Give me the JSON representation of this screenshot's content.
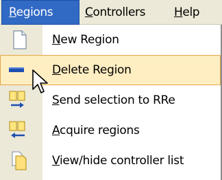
{
  "menubar": {
    "items": [
      {
        "mnemonic": "R",
        "rest": "egions"
      },
      {
        "mnemonic": "C",
        "rest": "ontrollers"
      },
      {
        "mnemonic": "H",
        "rest": "elp"
      }
    ]
  },
  "menu": {
    "items": [
      {
        "mnemonic": "N",
        "rest": "ew Region",
        "icon": "new-region-icon"
      },
      {
        "mnemonic": "D",
        "rest": "elete Region",
        "icon": "delete-region-icon"
      },
      {
        "mnemonic": "S",
        "rest": "end selection to RRe",
        "icon": "send-selection-icon"
      },
      {
        "mnemonic": "A",
        "rest": "cquire regions",
        "icon": "acquire-regions-icon"
      },
      {
        "mnemonic": "V",
        "rest": "iew/hide controller list",
        "icon": "controller-list-icon"
      }
    ]
  },
  "colors": {
    "menubar_bg": "#ece9d8",
    "open_menu_bg": "#316ac5",
    "hover_bg": "#ffeec2",
    "hover_border": "#e3a646"
  }
}
